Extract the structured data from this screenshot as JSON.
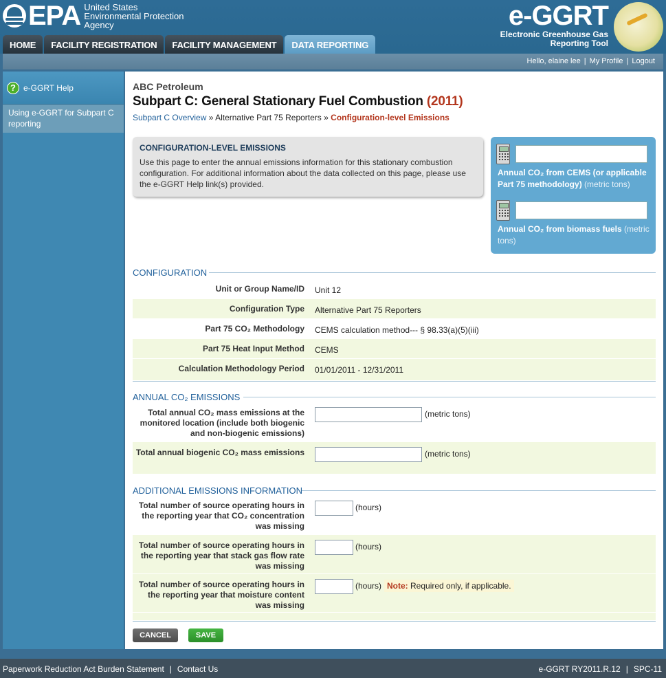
{
  "header": {
    "epa_text": "EPA",
    "agency_lines": [
      "United States",
      "Environmental Protection",
      "Agency"
    ],
    "app_title": "e-GGRT",
    "app_subtitle_lines": [
      "Electronic Greenhouse Gas",
      "Reporting Tool"
    ]
  },
  "nav": {
    "tabs": [
      {
        "label": "HOME",
        "active": false
      },
      {
        "label": "FACILITY REGISTRATION",
        "active": false
      },
      {
        "label": "FACILITY MANAGEMENT",
        "active": false
      },
      {
        "label": "DATA REPORTING",
        "active": true
      }
    ]
  },
  "userbar": {
    "greeting": "Hello, elaine lee",
    "profile": "My Profile",
    "logout": "Logout",
    "separator": "|"
  },
  "sidebar": {
    "help_label": "e-GGRT Help",
    "help_icon": "?",
    "items": [
      "Using e-GGRT for Subpart C reporting"
    ]
  },
  "page": {
    "company": "ABC Petroleum",
    "title": "Subpart C: General Stationary Fuel Combustion",
    "year": "(2011)",
    "breadcrumb": {
      "link": "Subpart C Overview",
      "sep1": " » ",
      "middle": "Alternative Part 75 Reporters",
      "sep2": " » ",
      "current": "Configuration-level Emissions"
    }
  },
  "infobox": {
    "title": "CONFIGURATION-LEVEL EMISSIONS",
    "text": "Use this page to enter the annual emissions information for this stationary combustion configuration. For additional information about the data collected on this page, please use the e-GGRT Help link(s) provided."
  },
  "calculator": {
    "cems_label": "Annual CO₂ from CEMS (or applicable Part 75 methodology)",
    "cems_unit": "(metric tons)",
    "cems_value": "",
    "biomass_label": "Annual CO₂ from biomass fuels",
    "biomass_unit": "(metric tons)",
    "biomass_value": ""
  },
  "configuration": {
    "section_title": "CONFIGURATION",
    "rows": [
      {
        "label": "Unit or Group Name/ID",
        "value": "Unit 12"
      },
      {
        "label": "Configuration Type",
        "value": "Alternative Part 75 Reporters"
      },
      {
        "label": "Part 75 CO₂ Methodology",
        "value": "CEMS calculation method--- § 98.33(a)(5)(iii)"
      },
      {
        "label": "Part 75 Heat Input Method",
        "value": "CEMS"
      },
      {
        "label": "Calculation Methodology Period",
        "value": "01/01/2011 - 12/31/2011"
      }
    ]
  },
  "annual_emissions": {
    "section_title": "ANNUAL CO₂ EMISSIONS",
    "rows": [
      {
        "label": "Total annual CO₂ mass emissions at the monitored location (include both biogenic and non-biogenic emissions)",
        "value": "",
        "unit": "(metric tons)"
      },
      {
        "label": "Total annual biogenic CO₂ mass emissions",
        "value": "",
        "unit": "(metric tons)"
      }
    ]
  },
  "additional": {
    "section_title": "ADDITIONAL EMISSIONS INFORMATION",
    "rows": [
      {
        "label": "Total number of source operating hours in the reporting year that CO₂ concentration was missing",
        "value": "",
        "unit": "(hours)"
      },
      {
        "label": "Total number of source operating hours in the reporting year that stack gas flow rate was missing",
        "value": "",
        "unit": "(hours)"
      },
      {
        "label": "Total number of source operating hours in the reporting year that moisture content was missing",
        "value": "",
        "unit": "(hours)"
      }
    ],
    "note_label": "Note:",
    "note_text": "Required only, if applicable."
  },
  "buttons": {
    "cancel": "CANCEL",
    "save": "SAVE"
  },
  "footer": {
    "paperwork": "Paperwork Reduction Act Burden Statement",
    "contact": "Contact Us",
    "version": "e-GGRT RY2011.R.12",
    "code": "SPC-11",
    "separator": "|"
  }
}
